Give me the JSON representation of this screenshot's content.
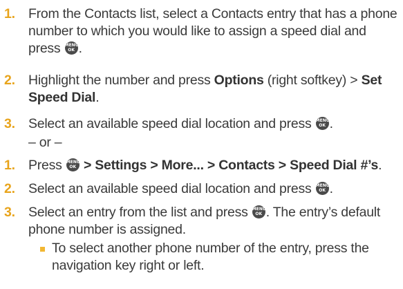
{
  "key_icon": {
    "name": "menu-ok-key-icon",
    "label_top": "MENU",
    "label_bottom": "OK",
    "color": "#4a4a4a"
  },
  "accent_color": "#e8a41c",
  "bullet_color": "#f2b733",
  "method1": {
    "step1": {
      "num": "1.",
      "text": "From the Contacts list, select a Contacts entry that has a phone number to which you would like to assign a speed dial and press",
      "end": "."
    },
    "step2": {
      "num": "2.",
      "text_a": "Highlight the number and press ",
      "options": "Options",
      "text_b": " (right softkey) > ",
      "set_speed_dial": "Set Speed Dial",
      "end": "."
    },
    "step3": {
      "num": "3.",
      "text": "Select an available speed dial location and press",
      "end": "."
    }
  },
  "separator": "– or –",
  "method2": {
    "step1": {
      "num": "1.",
      "text_a": "Press",
      "path": " > Settings > More... > Contacts > Speed Dial #’s",
      "end": "."
    },
    "step2": {
      "num": "2.",
      "text": "Select an available speed dial location and press",
      "end": "."
    },
    "step3": {
      "num": "3.",
      "text_a": "Select an entry from the list and press",
      "text_b": ". The entry’s default phone number is assigned."
    },
    "bullet": "To select another phone number of the entry, press the navigation key right or left."
  }
}
